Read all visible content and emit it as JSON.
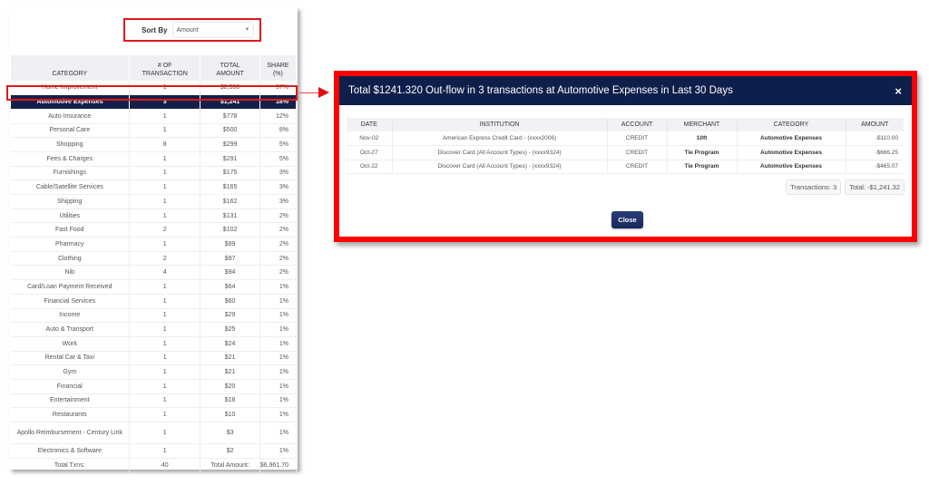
{
  "sort": {
    "label": "Sort By",
    "selected": "Amount"
  },
  "category_table": {
    "headers": {
      "category": "CATEGORY",
      "count_line1": "# OF",
      "count_line2": "TRANSACTION",
      "amount_line1": "TOTAL",
      "amount_line2": "AMOUNT",
      "share_line1": "SHARE",
      "share_line2": "(%)"
    },
    "rows": [
      {
        "category": "Home Improvement",
        "count": "1",
        "amount": "$2,530",
        "share": "37%"
      },
      {
        "category": "Automotive Expenses",
        "count": "3",
        "amount": "$1,241",
        "share": "18%"
      },
      {
        "category": "Auto Insurance",
        "count": "1",
        "amount": "$778",
        "share": "12%"
      },
      {
        "category": "Personal Care",
        "count": "1",
        "amount": "$500",
        "share": "8%"
      },
      {
        "category": "Shopping",
        "count": "8",
        "amount": "$299",
        "share": "5%"
      },
      {
        "category": "Fees & Charges",
        "count": "1",
        "amount": "$291",
        "share": "5%"
      },
      {
        "category": "Furnishings",
        "count": "1",
        "amount": "$175",
        "share": "3%"
      },
      {
        "category": "Cable/Satellite Services",
        "count": "1",
        "amount": "$165",
        "share": "3%"
      },
      {
        "category": "Shipping",
        "count": "1",
        "amount": "$162",
        "share": "3%"
      },
      {
        "category": "Utilities",
        "count": "1",
        "amount": "$131",
        "share": "2%"
      },
      {
        "category": "Fast Food",
        "count": "2",
        "amount": "$102",
        "share": "2%"
      },
      {
        "category": "Pharmacy",
        "count": "1",
        "amount": "$99",
        "share": "2%"
      },
      {
        "category": "Clothing",
        "count": "2",
        "amount": "$97",
        "share": "2%"
      },
      {
        "category": "Nib",
        "count": "4",
        "amount": "$94",
        "share": "2%"
      },
      {
        "category": "Card/Loan Payment Received",
        "count": "1",
        "amount": "$64",
        "share": "1%"
      },
      {
        "category": "Financial Services",
        "count": "1",
        "amount": "$60",
        "share": "1%"
      },
      {
        "category": "Income",
        "count": "1",
        "amount": "$29",
        "share": "1%"
      },
      {
        "category": "Auto & Transport",
        "count": "1",
        "amount": "$25",
        "share": "1%"
      },
      {
        "category": "Work",
        "count": "1",
        "amount": "$24",
        "share": "1%"
      },
      {
        "category": "Rental Car & Taxi",
        "count": "1",
        "amount": "$21",
        "share": "1%"
      },
      {
        "category": "Gym",
        "count": "1",
        "amount": "$21",
        "share": "1%"
      },
      {
        "category": "Financial",
        "count": "1",
        "amount": "$20",
        "share": "1%"
      },
      {
        "category": "Entertainment",
        "count": "1",
        "amount": "$18",
        "share": "1%"
      },
      {
        "category": "Restaurants",
        "count": "1",
        "amount": "$10",
        "share": "1%"
      },
      {
        "category": "Apollo Reimbursement - Century Link",
        "count": "1",
        "amount": "$3",
        "share": "1%"
      },
      {
        "category": "Electronics & Software",
        "count": "1",
        "amount": "$2",
        "share": "1%"
      }
    ],
    "highlighted_index": 1,
    "footer": {
      "txns_label": "Total Txns:",
      "txns_value": "40",
      "amount_label": "Total Amount:",
      "amount_value": "$6,961.70"
    }
  },
  "modal": {
    "title": "Total $1241.320 Out-flow in 3 transactions at Automotive Expenses in Last 30 Days",
    "close_icon": "×",
    "headers": [
      "DATE",
      "INSTITUTION",
      "ACCOUNT",
      "MERCHANT",
      "CATEGORY",
      "AMOUNT"
    ],
    "rows": [
      {
        "date": "Nov-02",
        "institution": "American Express Credit Card - (xxxx2006)",
        "account": "CREDIT",
        "merchant": "10ft",
        "category": "Automotive Expenses",
        "amount": "-$110.00"
      },
      {
        "date": "Oct-27",
        "institution": "Discover Card (All Account Types) - (xxxx9324)",
        "account": "CREDIT",
        "merchant": "Tie Program",
        "category": "Automotive Expenses",
        "amount": "-$666.25"
      },
      {
        "date": "Oct-22",
        "institution": "Discover Card (All Account Types) - (xxxx9324)",
        "account": "CREDIT",
        "merchant": "Tie Program",
        "category": "Automotive Expenses",
        "amount": "-$465.07"
      }
    ],
    "transactions_badge": "Transactions: 3",
    "total_badge": "Total: -$1,241.32",
    "close_button": "Close"
  },
  "colors": {
    "navy": "#0f1f4b",
    "highlight_red": "#ff0000"
  }
}
